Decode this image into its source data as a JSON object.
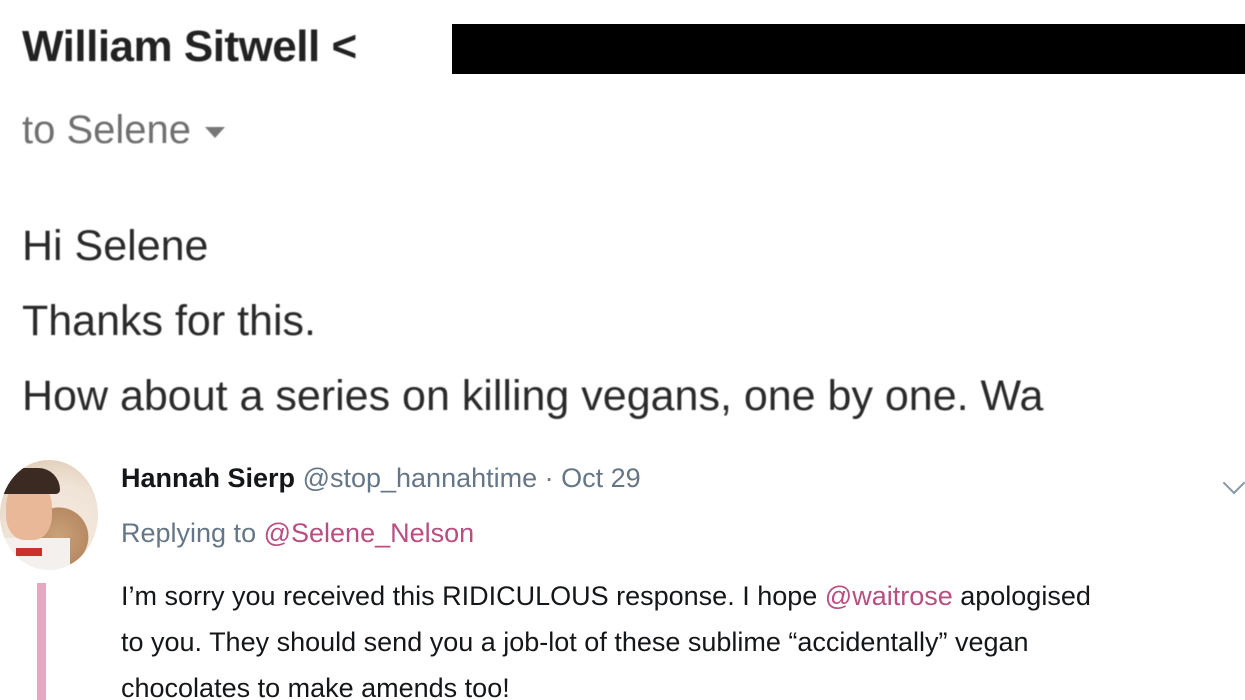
{
  "email": {
    "sender_name": "William Sitwell",
    "sender_email_visible": "<",
    "recipient_label": "to Selene",
    "body_lines": [
      "Hi Selene",
      "Thanks for this.",
      "How about a series on killing vegans, one by one. Wa"
    ]
  },
  "tweet": {
    "author_name": "Hannah Sierp",
    "handle": "@stop_hannahtime",
    "separator": "·",
    "date": "Oct 29",
    "replying_prefix": "Replying to",
    "replying_handle": "@Selene_Nelson",
    "text_line1_before": "I’m sorry you received this RIDICULOUS response. I hope ",
    "text_line1_mention": "@waitrose",
    "text_line1_after": " apologised",
    "text_line2": "to you. They should send you a job-lot of these sublime “accidentally” vegan",
    "text_line3": "chocolates to make amends too!",
    "icons": {
      "avatar": "avatar-photo",
      "menu": "chevron-down-icon"
    },
    "colors": {
      "link": "#b94e80",
      "muted": "#657786",
      "thread_line": "#e2a9c0"
    }
  }
}
